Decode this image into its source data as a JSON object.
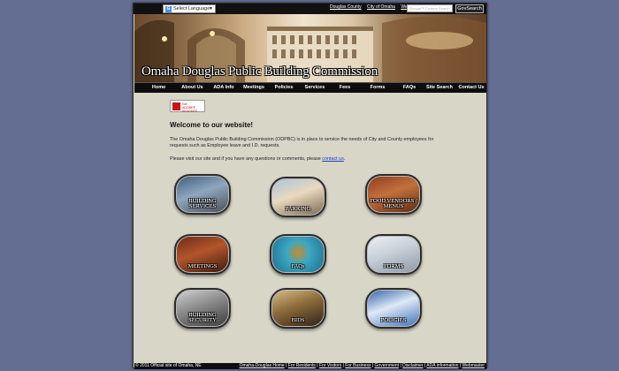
{
  "topbar": {
    "language_label": "Select Language",
    "links": [
      "Douglas County",
      "City of Omaha",
      "Web"
    ],
    "search_placeholder": "Google™ Custom Search",
    "search_button": "GovSearch"
  },
  "banner": {
    "title": "Omaha Douglas Public Building Commission"
  },
  "nav": [
    "Home",
    "About Us",
    "ADA Info",
    "Meetings",
    "Policies",
    "Services",
    "Fees",
    "Forms",
    "FAQs",
    "Site Search",
    "Contact Us"
  ],
  "acrobat": {
    "line1": "Get",
    "line2": "ADOBE® READER®"
  },
  "main": {
    "welcome": "Welcome to our website!",
    "intro": "The Omaha Douglas Public Building Commission (ODPBC) is in place to service the needs of City and County employees for requests such as Employee leave and I.D. requests.",
    "visit_text": "Please visit our site and if you have any questions or comments, please ",
    "visit_link": "contact us",
    "visit_end": "."
  },
  "tiles": [
    "BUILDING SERVICES",
    "PARKING",
    "FOOD VENDORS / MENUS",
    "MEETINGS",
    "FAQs",
    "FORMS",
    "BUILDING SECURITY",
    "BIDS",
    "POLICIES"
  ],
  "footer": {
    "copyright": "© 2011 Official site of Omaha, NE",
    "links": [
      "Omaha-Douglas Home",
      "For Residents",
      "For Visitors",
      "For Business",
      "Government",
      "Disclaimer",
      "ADA information",
      "Webmaster"
    ]
  },
  "colors": {
    "page_bg": "#646e93",
    "content_bg": "#d8d6c7",
    "bar": "#0d0d0d",
    "link": "#1a3cc2"
  }
}
